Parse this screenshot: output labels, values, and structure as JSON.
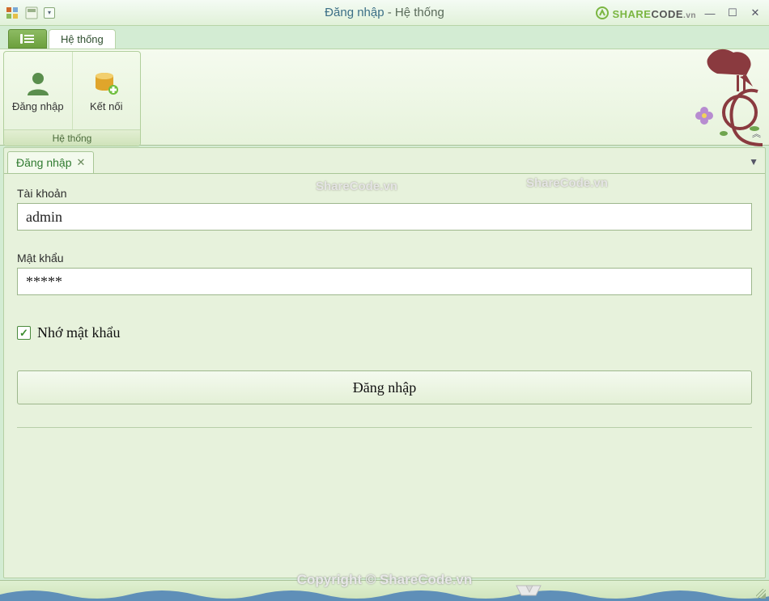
{
  "window": {
    "title_emph": "Đăng nhập",
    "title_sep": " - ",
    "title_rest": "Hệ thống"
  },
  "logo": {
    "text_share": "SHARE",
    "text_code": "CODE",
    "text_vn": ".vn"
  },
  "ribbon": {
    "tab_label": "Hệ thống",
    "group_caption": "Hệ thống",
    "btn_login": "Đăng nhập",
    "btn_connect": "Kết nối"
  },
  "doc_tab": {
    "label": "Đăng nhập"
  },
  "form": {
    "user_label": "Tài khoản",
    "user_value": "admin",
    "pass_label": "Mật khẩu",
    "pass_value": "*****",
    "remember_label": "Nhớ mật khẩu",
    "submit_label": "Đăng nhập"
  },
  "watermarks": {
    "wm": "ShareCode.vn",
    "copyright": "Copyright © ShareCode.vn"
  }
}
